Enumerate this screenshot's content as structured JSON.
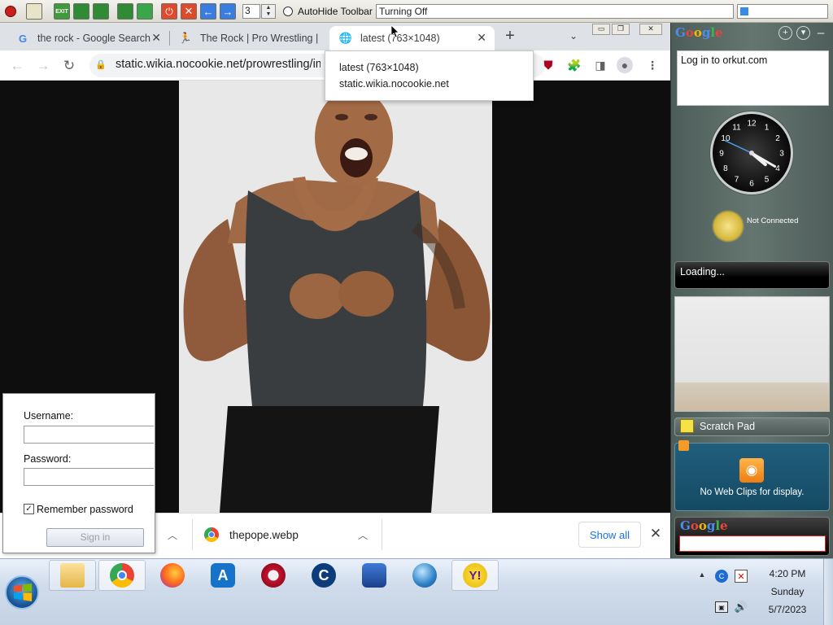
{
  "utility_bar": {
    "spin_value": "3",
    "autohide_label": "AutoHide Toolbar",
    "status_text": "Turning Off"
  },
  "browser": {
    "tabs": [
      {
        "title": "the rock - Google Search",
        "favicon": "google-g-icon",
        "active": false
      },
      {
        "title": "The Rock | Pro Wrestling |",
        "favicon": "wrestler-favicon-icon",
        "active": false
      },
      {
        "title": "latest (763×1048)",
        "favicon": "globe-icon",
        "active": true
      }
    ],
    "url": "static.wikia.nocookie.net/prowrestling/images",
    "tooltip": {
      "title": "latest (763×1048)",
      "domain": "static.wikia.nocookie.net"
    },
    "image_alt": "Dwayne The Rock Johnson flexing",
    "downloads": {
      "items": [
        {
          "name": "thepope.webp"
        }
      ],
      "show_all_label": "Show all"
    }
  },
  "login_popup": {
    "username_label": "Username:",
    "username_value": "",
    "password_label": "Password:",
    "password_value": "",
    "remember_label": "Remember password",
    "remember_checked": true,
    "signin_label": "Sign in"
  },
  "sidebar": {
    "logo_text": "Google",
    "orkut_text": "Log in to orkut.com",
    "clock": {
      "hour": 4,
      "minute": 20,
      "numerals": [
        "12",
        "1",
        "2",
        "3",
        "4",
        "5",
        "6",
        "7",
        "8",
        "9",
        "10",
        "11"
      ]
    },
    "weather_status": "Not Connected",
    "loading_text": "Loading...",
    "scratch_pad_label": "Scratch Pad",
    "webclips_text": "No Web Clips for display.",
    "search_logo": "Google"
  },
  "taskbar": {
    "apps": [
      "file-explorer-icon",
      "chrome-icon",
      "firefox-icon",
      "app-installer-icon",
      "red-circle-app-icon",
      "ccleaner-icon",
      "remote-desktop-icon",
      "globe-app-icon",
      "yahoo-messenger-icon"
    ],
    "clock": {
      "time": "4:20 PM",
      "day": "Sunday",
      "date": "5/7/2023"
    }
  },
  "colors": {
    "accent_blue": "#1a73e8",
    "tab_strip": "#dee1e6",
    "sidebar": "#5a6a66"
  }
}
